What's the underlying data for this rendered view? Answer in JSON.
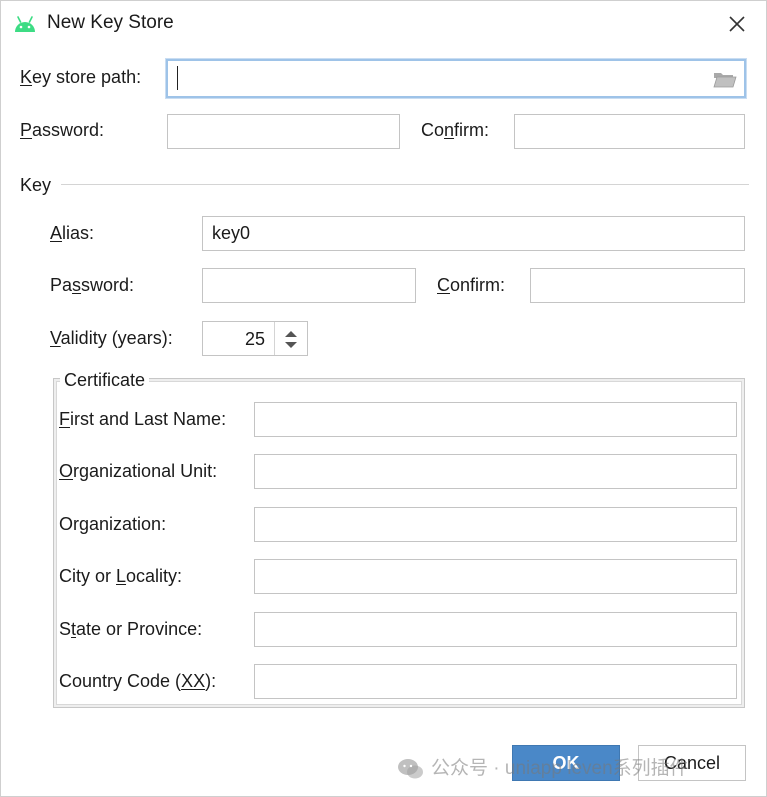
{
  "window": {
    "title": "New Key Store",
    "app_icon": "android-icon",
    "close_icon": "close-icon"
  },
  "keystore": {
    "path_label": "Key store path:",
    "path_label_mnemonic": "K",
    "path_label_rest": "ey store path:",
    "path_value": "",
    "password_label_pre": "P",
    "password_label_rest": "assword:",
    "confirm_label_pre": "Co",
    "confirm_label_mn": "n",
    "confirm_label_rest": "firm:",
    "folder_icon": "folder-icon"
  },
  "key": {
    "section_label": "Key",
    "alias_label_mn": "A",
    "alias_label_rest": "lias:",
    "alias_value": "key0",
    "password_label_pre": "Pa",
    "password_label_mn": "s",
    "password_label_rest": "sword:",
    "confirm_label_mn": "C",
    "confirm_label_rest": "onfirm:",
    "validity_label_mn": "V",
    "validity_label_rest": "alidity (years):",
    "validity_value": "25"
  },
  "certificate": {
    "title": "Certificate",
    "fields": [
      {
        "mn": "F",
        "pre": "",
        "rest": "irst and Last Name:",
        "value": ""
      },
      {
        "mn": "O",
        "pre": "",
        "rest": "rganizational Unit:",
        "value": ""
      },
      {
        "mn": "g",
        "pre": "Or",
        "rest": "anization:",
        "value": ""
      },
      {
        "mn": "L",
        "pre": "City or ",
        "rest": "ocality:",
        "value": ""
      },
      {
        "mn": "t",
        "pre": "S",
        "rest": "ate or Province:",
        "value": ""
      },
      {
        "mn": "XX",
        "pre": "Country Code (",
        "rest": "):",
        "value": ""
      }
    ]
  },
  "buttons": {
    "ok": "OK",
    "cancel": "Cancel"
  },
  "watermark": {
    "text": "公众号 · uniapp leven系列插件",
    "icon": "wechat-icon"
  },
  "colors": {
    "accent": "#4a88c8",
    "android_green": "#3ddc84",
    "focus_border": "#9ec3e8"
  }
}
